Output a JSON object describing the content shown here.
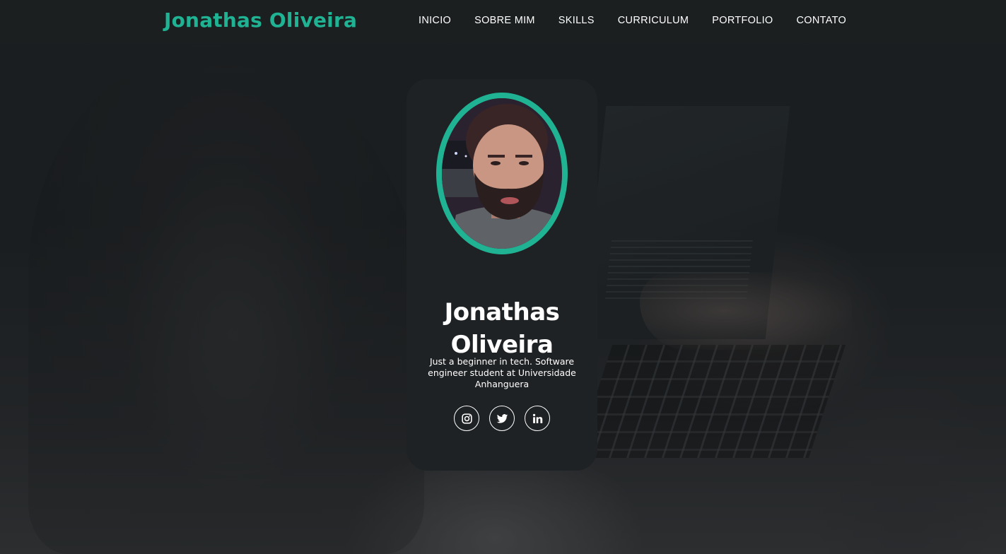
{
  "header": {
    "brand": "Jonathas Oliveira",
    "nav": [
      {
        "label": "INICIO"
      },
      {
        "label": "SOBRE MIM"
      },
      {
        "label": "SKILLS"
      },
      {
        "label": "CURRICULUM"
      },
      {
        "label": "PORTFOLIO"
      },
      {
        "label": "CONTATO"
      }
    ]
  },
  "profile": {
    "name": "Jonathas Oliveira",
    "bio": "Just a beginner in tech. Software engineer student at Universidade Anhanguera",
    "socials": [
      {
        "icon": "instagram-icon"
      },
      {
        "icon": "twitter-icon"
      },
      {
        "icon": "linkedin-icon"
      }
    ]
  },
  "colors": {
    "accent": "#1fb394",
    "card_bg": "#1f2224",
    "header_bg": "#1b1f21",
    "text": "#ffffff"
  }
}
